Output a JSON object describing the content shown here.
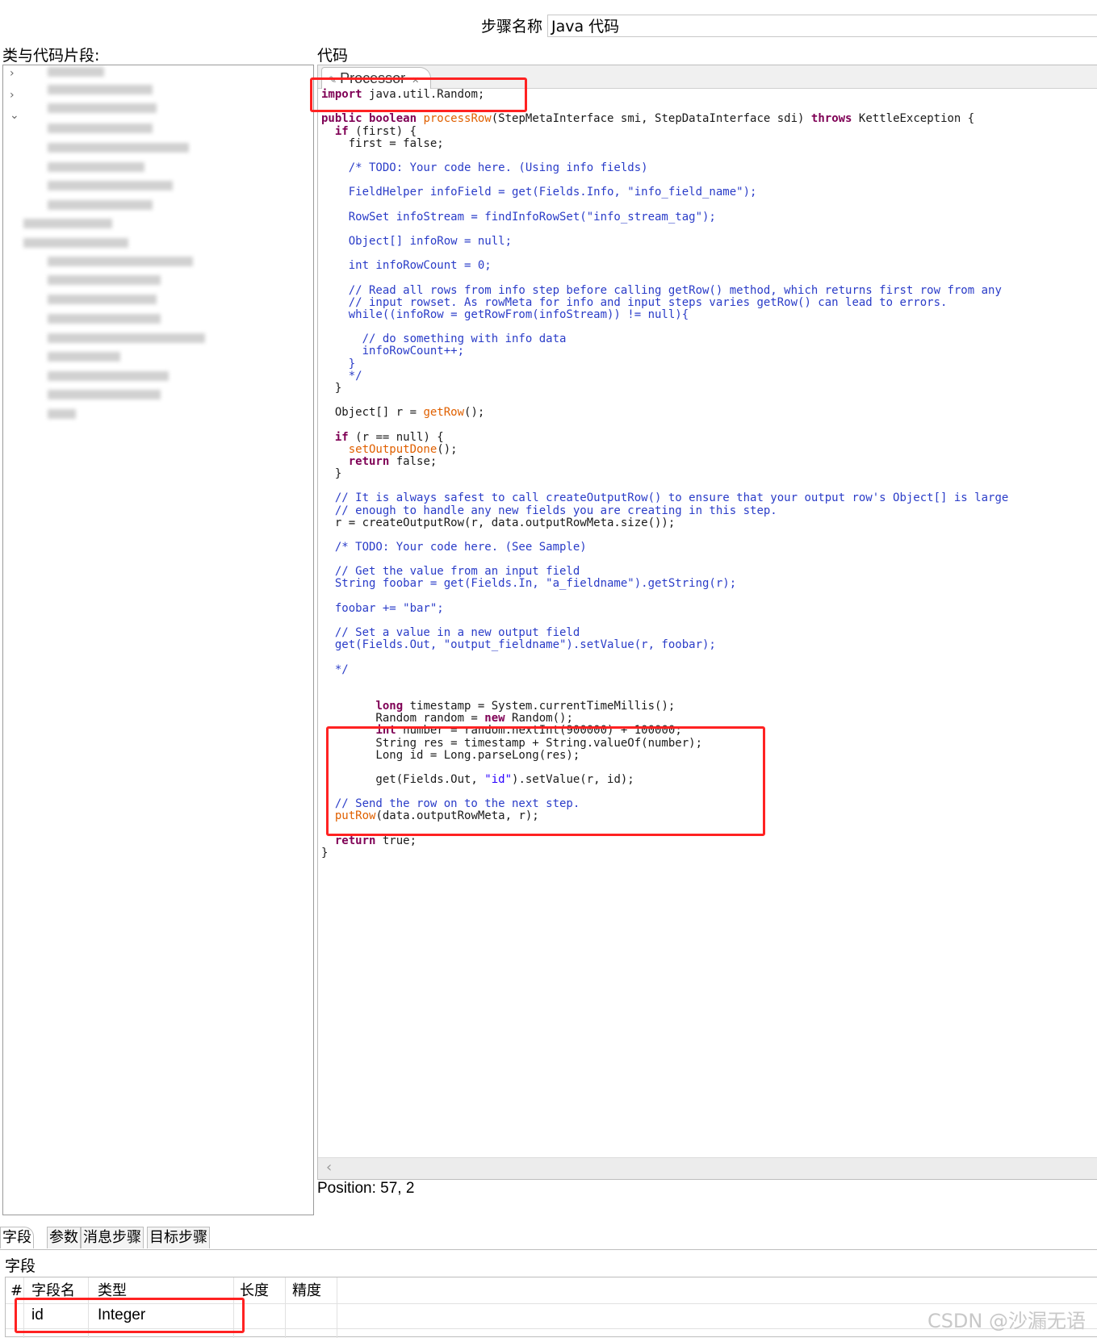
{
  "step_name": {
    "label": "步骤名称",
    "value": "Java 代码"
  },
  "left_panel": {
    "label": "类与代码片段:",
    "chevrons": [
      "›",
      "›",
      "⌄"
    ]
  },
  "editor": {
    "label": "代码",
    "tab": {
      "icon": "file-icon",
      "label": "Processor",
      "close_icon": "close-icon"
    },
    "position": "Position: 57, 2"
  },
  "code_lines": [
    {
      "t": 0,
      "segs": [
        [
          "kw",
          "import"
        ],
        [
          "",
          "java.util.Random;"
        ]
      ]
    },
    {
      "t": 30,
      "segs": [
        [
          "kw",
          "public boolean"
        ],
        [
          "fn",
          "processRow"
        ],
        [
          "",
          "(StepMetaInterface smi, StepDataInterface sdi) "
        ],
        [
          "kw",
          "throws"
        ],
        [
          "",
          "KettleException {"
        ]
      ]
    },
    {
      "t": 46,
      "segs": [
        [
          "",
          "  "
        ],
        [
          "kw",
          "if"
        ],
        [
          "",
          "(first) {"
        ]
      ]
    },
    {
      "t": 61,
      "segs": [
        [
          "",
          "    first = false;"
        ]
      ]
    },
    {
      "t": 91,
      "segs": [
        [
          "cm",
          "    /* TODO: Your code here. (Using info fields)"
        ]
      ]
    },
    {
      "t": 121,
      "segs": [
        [
          "cm",
          "    FieldHelper infoField = get(Fields.Info, \"info_field_name\");"
        ]
      ]
    },
    {
      "t": 152,
      "segs": [
        [
          "cm",
          "    RowSet infoStream = findInfoRowSet(\"info_stream_tag\");"
        ]
      ]
    },
    {
      "t": 182,
      "segs": [
        [
          "cm",
          "    Object[] infoRow = null;"
        ]
      ]
    },
    {
      "t": 212,
      "segs": [
        [
          "cm",
          "    int infoRowCount = 0;"
        ]
      ]
    },
    {
      "t": 243,
      "segs": [
        [
          "cm",
          "    // Read all rows from info step before calling getRow() method, which returns first row from any"
        ]
      ]
    },
    {
      "t": 258,
      "segs": [
        [
          "cm",
          "    // input rowset. As rowMeta for info and input steps varies getRow() can lead to errors."
        ]
      ]
    },
    {
      "t": 273,
      "segs": [
        [
          "cm",
          "    while((infoRow = getRowFrom(infoStream)) != null){"
        ]
      ]
    },
    {
      "t": 303,
      "segs": [
        [
          "cm",
          "      // do something with info data"
        ]
      ]
    },
    {
      "t": 318,
      "segs": [
        [
          "cm",
          "      infoRowCount++;"
        ]
      ]
    },
    {
      "t": 334,
      "segs": [
        [
          "cm",
          "    }"
        ]
      ]
    },
    {
      "t": 349,
      "segs": [
        [
          "cm",
          "    */"
        ]
      ]
    },
    {
      "t": 364,
      "segs": [
        [
          "",
          "  }"
        ]
      ]
    },
    {
      "t": 394,
      "segs": [
        [
          "",
          "  Object[] r = "
        ],
        [
          "fn",
          "getRow"
        ],
        [
          "",
          "();"
        ]
      ]
    },
    {
      "t": 425,
      "segs": [
        [
          "",
          "  "
        ],
        [
          "kw",
          "if"
        ],
        [
          "",
          "(r == null) {"
        ]
      ]
    },
    {
      "t": 440,
      "segs": [
        [
          "",
          "    "
        ],
        [
          "fn",
          "setOutputDone"
        ],
        [
          "",
          "();"
        ]
      ]
    },
    {
      "t": 455,
      "segs": [
        [
          "",
          "    "
        ],
        [
          "kw",
          "return"
        ],
        [
          "",
          "false;"
        ]
      ]
    },
    {
      "t": 470,
      "segs": [
        [
          "",
          "  }"
        ]
      ]
    },
    {
      "t": 500,
      "segs": [
        [
          "cm",
          "  // It is always safest to call createOutputRow() to ensure that your output row's Object[] is large"
        ]
      ]
    },
    {
      "t": 516,
      "segs": [
        [
          "cm",
          "  // enough to handle any new fields you are creating in this step."
        ]
      ]
    },
    {
      "t": 531,
      "segs": [
        [
          "",
          "  r = createOutputRow(r, data.outputRowMeta.size());"
        ]
      ]
    },
    {
      "t": 561,
      "segs": [
        [
          "cm",
          "  /* TODO: Your code here. (See Sample)"
        ]
      ]
    },
    {
      "t": 591,
      "segs": [
        [
          "cm",
          "  // Get the value from an input field"
        ]
      ]
    },
    {
      "t": 606,
      "segs": [
        [
          "cm",
          "  String foobar = get(Fields.In, \"a_fieldname\").getString(r);"
        ]
      ]
    },
    {
      "t": 637,
      "segs": [
        [
          "cm",
          "  foobar += \"bar\";"
        ]
      ]
    },
    {
      "t": 667,
      "segs": [
        [
          "cm",
          "  // Set a value in a new output field"
        ]
      ]
    },
    {
      "t": 682,
      "segs": [
        [
          "cm",
          "  get(Fields.Out, \"output_fieldname\").setValue(r, foobar);"
        ]
      ]
    },
    {
      "t": 713,
      "segs": [
        [
          "cm",
          "  */"
        ]
      ]
    },
    {
      "t": 758,
      "segs": [
        [
          "",
          "        "
        ],
        [
          "kw",
          "long"
        ],
        [
          "",
          "timestamp = System.currentTimeMillis();"
        ]
      ]
    },
    {
      "t": 773,
      "segs": [
        [
          "",
          "        Random random = "
        ],
        [
          "kw",
          "new"
        ],
        [
          "",
          "Random();"
        ]
      ]
    },
    {
      "t": 788,
      "segs": [
        [
          "",
          "        "
        ],
        [
          "kw",
          "int"
        ],
        [
          "",
          "number = random.nextInt(900000) + 100000;"
        ]
      ]
    },
    {
      "t": 804,
      "segs": [
        [
          "",
          "        String res = timestamp + String.valueOf(number);"
        ]
      ]
    },
    {
      "t": 819,
      "segs": [
        [
          "",
          "        Long id = Long.parseLong(res);"
        ]
      ]
    },
    {
      "t": 849,
      "segs": [
        [
          "",
          "        get(Fields.Out, "
        ],
        [
          "str",
          "\"id\""
        ],
        [
          "",
          ").setValue(r, id);"
        ]
      ]
    },
    {
      "t": 879,
      "segs": [
        [
          "cm",
          "  // Send the row on to the next step."
        ]
      ]
    },
    {
      "t": 894,
      "segs": [
        [
          "",
          "  "
        ],
        [
          "fn",
          "putRow"
        ],
        [
          "",
          "(data.outputRowMeta, r);"
        ]
      ]
    },
    {
      "t": 925,
      "segs": [
        [
          "",
          "  "
        ],
        [
          "kw",
          "return"
        ],
        [
          "",
          "true;"
        ]
      ]
    },
    {
      "t": 940,
      "segs": [
        [
          "",
          "}"
        ]
      ]
    }
  ],
  "bottom_tabs": [
    "字段",
    "参数",
    "消息步骤",
    "目标步骤"
  ],
  "fields": {
    "label": "字段",
    "columns": [
      "#",
      "字段名",
      "类型",
      "长度",
      "精度"
    ],
    "rows": [
      [
        "",
        "id",
        "Integer",
        "",
        ""
      ]
    ]
  },
  "watermark": "CSDN @沙漏无语",
  "colors": {
    "highlight": "#ff2222",
    "keyword": "#7f0055",
    "method": "#e06000",
    "comment": "#2a3cc8"
  }
}
